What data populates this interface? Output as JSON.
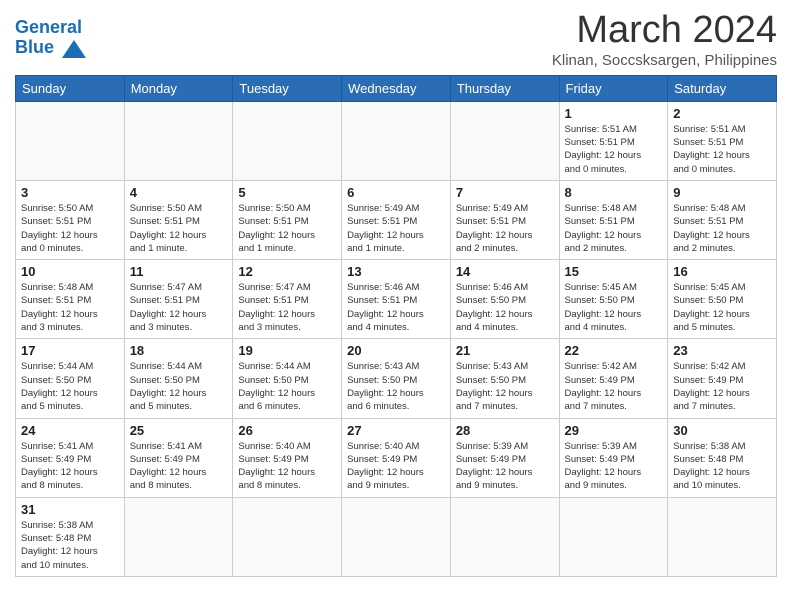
{
  "header": {
    "logo_general": "General",
    "logo_blue": "Blue",
    "title": "March 2024",
    "location": "Klinan, Soccsksargen, Philippines"
  },
  "weekdays": [
    "Sunday",
    "Monday",
    "Tuesday",
    "Wednesday",
    "Thursday",
    "Friday",
    "Saturday"
  ],
  "weeks": [
    [
      {
        "day": "",
        "info": ""
      },
      {
        "day": "",
        "info": ""
      },
      {
        "day": "",
        "info": ""
      },
      {
        "day": "",
        "info": ""
      },
      {
        "day": "",
        "info": ""
      },
      {
        "day": "1",
        "info": "Sunrise: 5:51 AM\nSunset: 5:51 PM\nDaylight: 12 hours\nand 0 minutes."
      },
      {
        "day": "2",
        "info": "Sunrise: 5:51 AM\nSunset: 5:51 PM\nDaylight: 12 hours\nand 0 minutes."
      }
    ],
    [
      {
        "day": "3",
        "info": "Sunrise: 5:50 AM\nSunset: 5:51 PM\nDaylight: 12 hours\nand 0 minutes."
      },
      {
        "day": "4",
        "info": "Sunrise: 5:50 AM\nSunset: 5:51 PM\nDaylight: 12 hours\nand 1 minute."
      },
      {
        "day": "5",
        "info": "Sunrise: 5:50 AM\nSunset: 5:51 PM\nDaylight: 12 hours\nand 1 minute."
      },
      {
        "day": "6",
        "info": "Sunrise: 5:49 AM\nSunset: 5:51 PM\nDaylight: 12 hours\nand 1 minute."
      },
      {
        "day": "7",
        "info": "Sunrise: 5:49 AM\nSunset: 5:51 PM\nDaylight: 12 hours\nand 2 minutes."
      },
      {
        "day": "8",
        "info": "Sunrise: 5:48 AM\nSunset: 5:51 PM\nDaylight: 12 hours\nand 2 minutes."
      },
      {
        "day": "9",
        "info": "Sunrise: 5:48 AM\nSunset: 5:51 PM\nDaylight: 12 hours\nand 2 minutes."
      }
    ],
    [
      {
        "day": "10",
        "info": "Sunrise: 5:48 AM\nSunset: 5:51 PM\nDaylight: 12 hours\nand 3 minutes."
      },
      {
        "day": "11",
        "info": "Sunrise: 5:47 AM\nSunset: 5:51 PM\nDaylight: 12 hours\nand 3 minutes."
      },
      {
        "day": "12",
        "info": "Sunrise: 5:47 AM\nSunset: 5:51 PM\nDaylight: 12 hours\nand 3 minutes."
      },
      {
        "day": "13",
        "info": "Sunrise: 5:46 AM\nSunset: 5:51 PM\nDaylight: 12 hours\nand 4 minutes."
      },
      {
        "day": "14",
        "info": "Sunrise: 5:46 AM\nSunset: 5:50 PM\nDaylight: 12 hours\nand 4 minutes."
      },
      {
        "day": "15",
        "info": "Sunrise: 5:45 AM\nSunset: 5:50 PM\nDaylight: 12 hours\nand 4 minutes."
      },
      {
        "day": "16",
        "info": "Sunrise: 5:45 AM\nSunset: 5:50 PM\nDaylight: 12 hours\nand 5 minutes."
      }
    ],
    [
      {
        "day": "17",
        "info": "Sunrise: 5:44 AM\nSunset: 5:50 PM\nDaylight: 12 hours\nand 5 minutes."
      },
      {
        "day": "18",
        "info": "Sunrise: 5:44 AM\nSunset: 5:50 PM\nDaylight: 12 hours\nand 5 minutes."
      },
      {
        "day": "19",
        "info": "Sunrise: 5:44 AM\nSunset: 5:50 PM\nDaylight: 12 hours\nand 6 minutes."
      },
      {
        "day": "20",
        "info": "Sunrise: 5:43 AM\nSunset: 5:50 PM\nDaylight: 12 hours\nand 6 minutes."
      },
      {
        "day": "21",
        "info": "Sunrise: 5:43 AM\nSunset: 5:50 PM\nDaylight: 12 hours\nand 7 minutes."
      },
      {
        "day": "22",
        "info": "Sunrise: 5:42 AM\nSunset: 5:49 PM\nDaylight: 12 hours\nand 7 minutes."
      },
      {
        "day": "23",
        "info": "Sunrise: 5:42 AM\nSunset: 5:49 PM\nDaylight: 12 hours\nand 7 minutes."
      }
    ],
    [
      {
        "day": "24",
        "info": "Sunrise: 5:41 AM\nSunset: 5:49 PM\nDaylight: 12 hours\nand 8 minutes."
      },
      {
        "day": "25",
        "info": "Sunrise: 5:41 AM\nSunset: 5:49 PM\nDaylight: 12 hours\nand 8 minutes."
      },
      {
        "day": "26",
        "info": "Sunrise: 5:40 AM\nSunset: 5:49 PM\nDaylight: 12 hours\nand 8 minutes."
      },
      {
        "day": "27",
        "info": "Sunrise: 5:40 AM\nSunset: 5:49 PM\nDaylight: 12 hours\nand 9 minutes."
      },
      {
        "day": "28",
        "info": "Sunrise: 5:39 AM\nSunset: 5:49 PM\nDaylight: 12 hours\nand 9 minutes."
      },
      {
        "day": "29",
        "info": "Sunrise: 5:39 AM\nSunset: 5:49 PM\nDaylight: 12 hours\nand 9 minutes."
      },
      {
        "day": "30",
        "info": "Sunrise: 5:38 AM\nSunset: 5:48 PM\nDaylight: 12 hours\nand 10 minutes."
      }
    ],
    [
      {
        "day": "31",
        "info": "Sunrise: 5:38 AM\nSunset: 5:48 PM\nDaylight: 12 hours\nand 10 minutes."
      },
      {
        "day": "",
        "info": ""
      },
      {
        "day": "",
        "info": ""
      },
      {
        "day": "",
        "info": ""
      },
      {
        "day": "",
        "info": ""
      },
      {
        "day": "",
        "info": ""
      },
      {
        "day": "",
        "info": ""
      }
    ]
  ]
}
